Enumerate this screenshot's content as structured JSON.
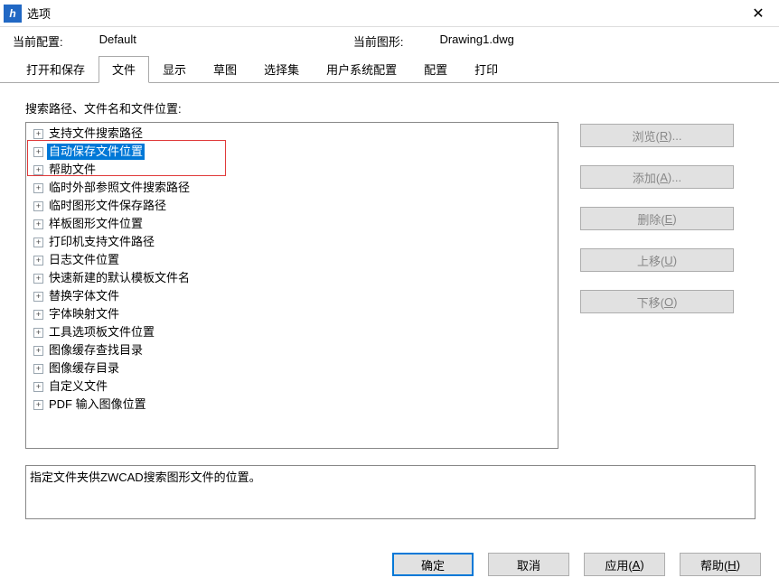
{
  "window": {
    "title": "选项",
    "icon_glyph": "h"
  },
  "info": {
    "config_label": "当前配置:",
    "config_value": "Default",
    "drawing_label": "当前图形:",
    "drawing_value": "Drawing1.dwg"
  },
  "tabs": [
    {
      "label": "打开和保存",
      "active": false
    },
    {
      "label": "文件",
      "active": true
    },
    {
      "label": "显示",
      "active": false
    },
    {
      "label": "草图",
      "active": false
    },
    {
      "label": "选择集",
      "active": false
    },
    {
      "label": "用户系统配置",
      "active": false
    },
    {
      "label": "配置",
      "active": false
    },
    {
      "label": "打印",
      "active": false
    }
  ],
  "section_label": "搜索路径、文件名和文件位置:",
  "tree": [
    {
      "label": "支持文件搜索路径",
      "selected": false
    },
    {
      "label": "自动保存文件位置",
      "selected": true
    },
    {
      "label": "帮助文件",
      "selected": false
    },
    {
      "label": "临时外部参照文件搜索路径",
      "selected": false
    },
    {
      "label": "临时图形文件保存路径",
      "selected": false
    },
    {
      "label": "样板图形文件位置",
      "selected": false
    },
    {
      "label": "打印机支持文件路径",
      "selected": false
    },
    {
      "label": "日志文件位置",
      "selected": false
    },
    {
      "label": "快速新建的默认模板文件名",
      "selected": false
    },
    {
      "label": "替换字体文件",
      "selected": false
    },
    {
      "label": "字体映射文件",
      "selected": false
    },
    {
      "label": "工具选项板文件位置",
      "selected": false
    },
    {
      "label": "图像缓存查找目录",
      "selected": false
    },
    {
      "label": "图像缓存目录",
      "selected": false
    },
    {
      "label": "自定义文件",
      "selected": false
    },
    {
      "label": "PDF 输入图像位置",
      "selected": false
    }
  ],
  "side_buttons": {
    "browse": {
      "text": "浏览(",
      "accel": "R",
      "suffix": ")..."
    },
    "add": {
      "text": "添加(",
      "accel": "A",
      "suffix": ")..."
    },
    "delete": {
      "text": "删除(",
      "accel": "E",
      "suffix": ")"
    },
    "moveup": {
      "text": "上移(",
      "accel": "U",
      "suffix": ")"
    },
    "movedn": {
      "text": "下移(",
      "accel": "O",
      "suffix": ")"
    }
  },
  "description": "指定文件夹供ZWCAD搜索图形文件的位置。",
  "footer": {
    "ok": "确定",
    "cancel": "取消",
    "apply": {
      "text": "应用(",
      "accel": "A",
      "suffix": ")"
    },
    "help": {
      "text": "帮助(",
      "accel": "H",
      "suffix": ")"
    }
  }
}
